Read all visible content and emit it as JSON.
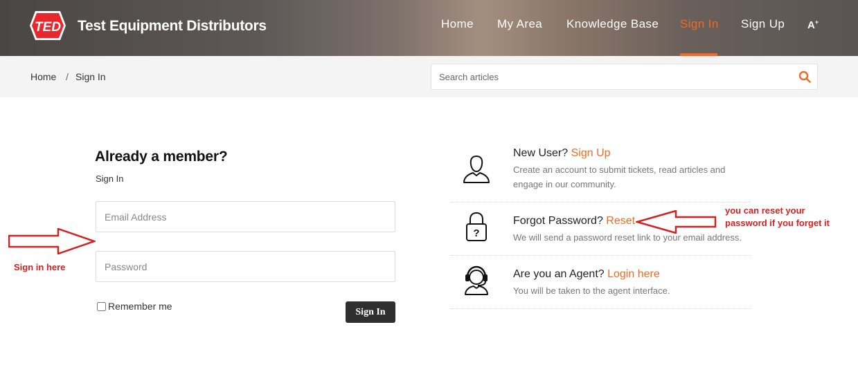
{
  "header": {
    "brand": "Test Equipment Distributors",
    "logo_text": "TED",
    "accent_color": "#f26a21",
    "nav": [
      {
        "label": "Home"
      },
      {
        "label": "My Area"
      },
      {
        "label": "Knowledge Base"
      },
      {
        "label": "Sign In",
        "active": true
      },
      {
        "label": "Sign Up"
      }
    ],
    "accessibility_label": "A"
  },
  "breadcrumb": {
    "items": [
      "Home",
      "Sign In"
    ],
    "separator": "/"
  },
  "search": {
    "placeholder": "Search articles",
    "icon": "search-icon"
  },
  "signin": {
    "heading": "Already a member?",
    "subheading": "Sign In",
    "email_placeholder": "Email Address",
    "password_placeholder": "Password",
    "remember_label": "Remember me",
    "remember_checked": false,
    "submit_label": "Sign In"
  },
  "options": [
    {
      "icon": "user-icon",
      "prefix": "New User?",
      "link": "Sign Up",
      "desc": "Create an account to submit tickets, read articles and engage in our community."
    },
    {
      "icon": "lock-icon",
      "prefix": "Forgot Password?",
      "link": "Reset",
      "desc": "We will send a password reset link to your email address."
    },
    {
      "icon": "headset-agent-icon",
      "prefix": "Are you an Agent?",
      "link": "Login here",
      "desc": "You will be taken to the agent interface."
    }
  ],
  "annotations": {
    "signin_note": "Sign in here",
    "reset_note_line1": "you can reset your",
    "reset_note_line2": "password if you forget it",
    "color": "#d42020"
  }
}
